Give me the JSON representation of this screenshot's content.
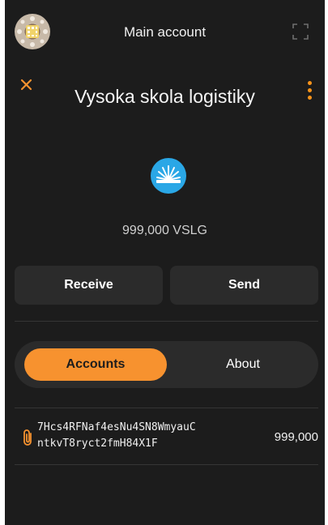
{
  "header": {
    "account_title": "Main account"
  },
  "token": {
    "name": "Vysoka skola logistiky",
    "balance": "999,000 VSLG"
  },
  "actions": {
    "receive_label": "Receive",
    "send_label": "Send"
  },
  "tabs": [
    {
      "label": "Accounts",
      "active": true
    },
    {
      "label": "About",
      "active": false
    }
  ],
  "accounts": [
    {
      "address_line1": "7Hcs4RFNaf4esNu4SN8WmyauC",
      "address_line2": "ntkvT8ryct2fmH84X1F",
      "amount": "999,000",
      "icon": "paperclip-icon"
    }
  ],
  "colors": {
    "accent": "#f7922f",
    "background": "#1c1c1c",
    "surface": "#2b2b2b",
    "logo": "#2aa7e6"
  }
}
